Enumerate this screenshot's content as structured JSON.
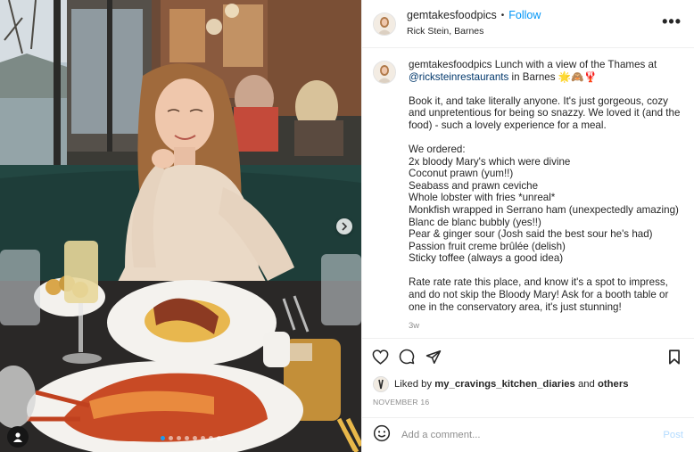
{
  "post": {
    "username": "gemtakesfoodpics",
    "follow_label": "Follow",
    "location": "Rick Stein, Barnes",
    "more_label": "•••",
    "caption": {
      "username": "gemtakesfoodpics",
      "intro": "Lunch with a view of the Thames at",
      "mention": "@ricksteinrestaurants",
      "intro_end": "in Barnes 🌟🙈🦞",
      "para2": "Book it, and take literally anyone. It's just gorgeous, cozy and unpretentious for being so snazzy. We loved it (and the food) - such a lovely experience for a meal.",
      "ordered_heading": "We ordered:",
      "ordered": [
        "2x bloody Mary's which were divine",
        "Coconut prawn (yum!!)",
        "Seabass and prawn ceviche",
        "Whole lobster with fries *unreal*",
        "Monkfish wrapped in Serrano ham (unexpectedly amazing)",
        "Blanc de blanc bubbly (yes!!)",
        "Pear & ginger sour (Josh said the best sour he's had)",
        "Passion fruit creme brûlée (delish)",
        "Sticky toffee (always a good idea)"
      ],
      "para4": "Rate rate rate this place, and know it's a spot to impress, and do not skip the Bloody Mary! Ask for a booth table or one in the conservatory area, it's just stunning!",
      "age": "3w"
    },
    "likes": {
      "prefix": "Liked by",
      "user": "my_cravings_kitchen_diaries",
      "and": "and",
      "others": "others"
    },
    "date": "NOVEMBER 16",
    "comment": {
      "placeholder": "Add a comment...",
      "post_label": "Post"
    },
    "carousel": {
      "total": 8,
      "active_index": 0
    }
  },
  "colors": {
    "link": "#0095f6",
    "mention": "#00376b",
    "muted": "#8e8e8e",
    "post_disabled": "#b3dbff",
    "border": "#efefef"
  },
  "icons": {
    "like": "heart-icon",
    "comment": "comment-icon",
    "share": "paper-plane-icon",
    "save": "bookmark-icon",
    "emoji": "smiley-icon",
    "tag": "user-tag-icon",
    "next": "chevron-right-icon"
  }
}
